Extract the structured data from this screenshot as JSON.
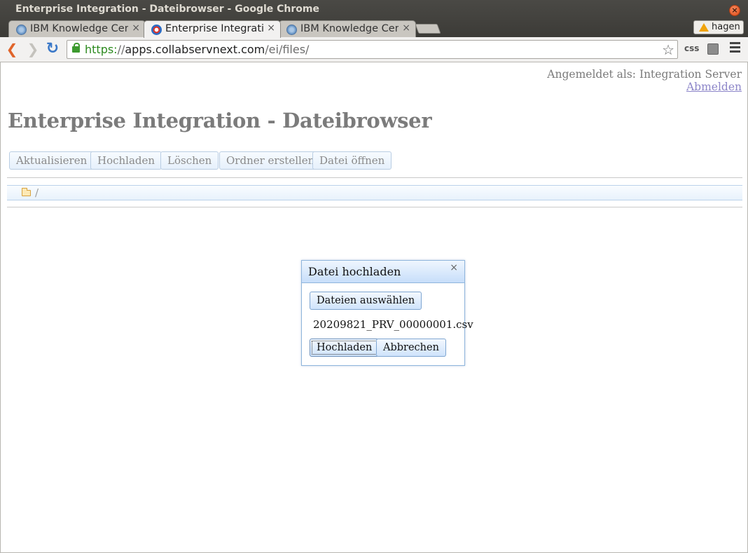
{
  "window": {
    "title": "Enterprise Integration - Dateibrowser - Google Chrome",
    "close_glyph": "×"
  },
  "tabs": [
    {
      "label": "IBM Knowledge Center",
      "close": "×",
      "active": false
    },
    {
      "label": "Enterprise Integration - Dateibrowser",
      "close": "×",
      "active": true
    },
    {
      "label": "IBM Knowledge Center",
      "close": "×",
      "active": false
    }
  ],
  "profile": {
    "name": "hagen"
  },
  "toolbar": {
    "back_glyph": "❮",
    "forward_glyph": "❯",
    "reload_glyph": "↻",
    "url_scheme": "https:",
    "url_sep": "//",
    "url_host": "apps.collabservnext.com",
    "url_path": "/ei/files/",
    "star_glyph": "☆",
    "ext_css": "css"
  },
  "header": {
    "logged_in_as": "Angemeldet als: Integration Server",
    "logout": "Abmelden",
    "title": "Enterprise Integration - Dateibrowser"
  },
  "actions": {
    "refresh": "Aktualisieren",
    "upload": "Hochladen",
    "delete": "Löschen",
    "create_folder": "Ordner erstellen",
    "open_file": "Datei öffnen"
  },
  "path": {
    "current": "/"
  },
  "dialog": {
    "title": "Datei hochladen",
    "close_glyph": "×",
    "choose_files": "Dateien auswählen",
    "selected_file": "20209821_PRV_00000001.csv",
    "upload": "Hochladen",
    "cancel": "Abbrechen"
  },
  "colors": {
    "accent_blue": "#8fb5dc",
    "title_gray": "#7b7b7b",
    "link": "#8d86c9"
  }
}
